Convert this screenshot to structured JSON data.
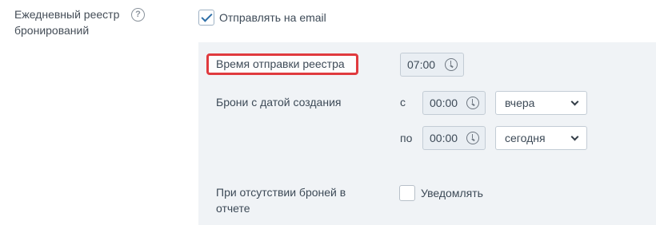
{
  "settings": {
    "daily_registry_label": "Ежедневный реестр бронирований",
    "help_glyph": "?",
    "send_email": {
      "label": "Отправлять на email",
      "checked": true
    }
  },
  "panel": {
    "send_time": {
      "label": "Время отправки реестра",
      "value": "07:00"
    },
    "created_range": {
      "label": "Брони с датой создания",
      "from_label": "с",
      "from_time": "00:00",
      "from_day": "вчера",
      "to_label": "по",
      "to_time": "00:00",
      "to_day": "сегодня"
    },
    "no_bookings": {
      "label": "При отсутствии броней в отчете",
      "notify_label": "Уведомлять",
      "checked": false
    }
  },
  "colors": {
    "panel_bg": "#f0f3f6",
    "highlight": "#e03a3e",
    "checkmark": "#2f6fa7"
  },
  "icons": [
    "help-icon",
    "checkmark-icon",
    "clock-icon",
    "chevron-down-icon"
  ]
}
